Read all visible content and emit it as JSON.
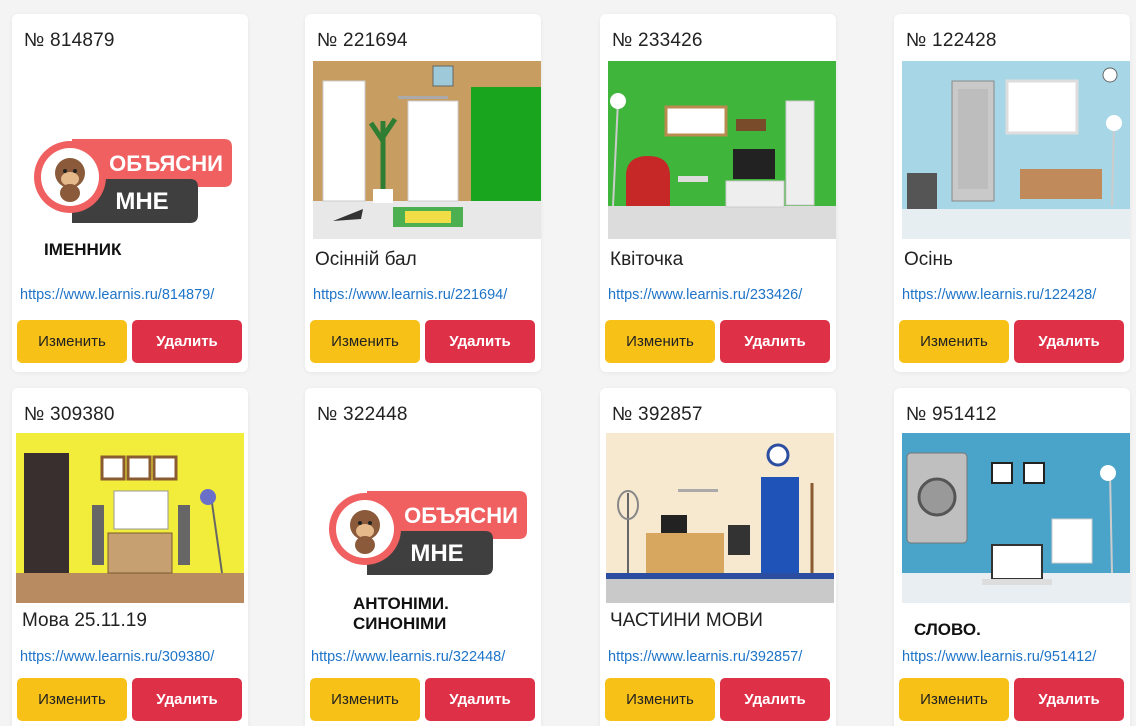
{
  "cards": [
    {
      "number": "№ 814879",
      "title": "ІМЕННИК",
      "link": "https://www.learnis.ru/814879/",
      "edit_label": "Изменить",
      "delete_label": "Удалить",
      "logo_text": [
        "ОБЪЯСНИ",
        "МНЕ"
      ]
    },
    {
      "number": "№ 221694",
      "title": "Осінній бал",
      "link": "https://www.learnis.ru/221694/",
      "edit_label": "Изменить",
      "delete_label": "Удалить"
    },
    {
      "number": "№ 233426",
      "title": "Квіточка",
      "link": "https://www.learnis.ru/233426/",
      "edit_label": "Изменить",
      "delete_label": "Удалить"
    },
    {
      "number": "№ 122428",
      "title": "Осінь",
      "link": "https://www.learnis.ru/122428/",
      "edit_label": "Изменить",
      "delete_label": "Удалить"
    },
    {
      "number": "№ 309380",
      "title": "Мова 25.11.19",
      "link": "https://www.learnis.ru/309380/",
      "edit_label": "Изменить",
      "delete_label": "Удалить"
    },
    {
      "number": "№ 322448",
      "title_lines": [
        "АНТОНІМИ.",
        "СИНОНІМИ"
      ],
      "link": "https://www.learnis.ru/322448/",
      "edit_label": "Изменить",
      "delete_label": "Удалить",
      "logo_text": [
        "ОБЪЯСНИ",
        "МНЕ"
      ]
    },
    {
      "number": "№ 392857",
      "title": "ЧАСТИНИ МОВИ",
      "link": "https://www.learnis.ru/392857/",
      "edit_label": "Изменить",
      "delete_label": "Удалить"
    },
    {
      "number": "№ 951412",
      "title": "СЛОВО.",
      "link": "https://www.learnis.ru/951412/",
      "edit_label": "Изменить",
      "delete_label": "Удалить"
    }
  ],
  "colors": {
    "edit_button": "#f7c117",
    "delete_button": "#de3148",
    "link": "#1e74c8"
  }
}
